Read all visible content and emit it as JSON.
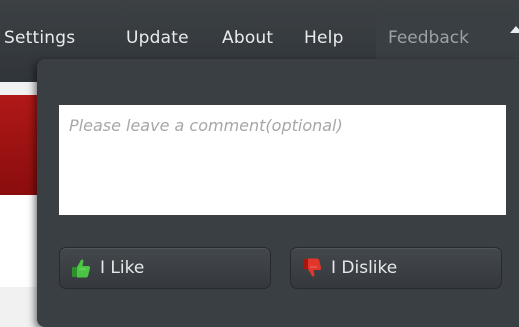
{
  "menu": {
    "settings": "Settings",
    "update": "Update",
    "about": "About",
    "help": "Help",
    "feedback": "Feedback"
  },
  "feedback_panel": {
    "comment_placeholder": "Please leave a comment(optional)",
    "comment_value": "",
    "like_label": "I Like",
    "dislike_label": "I Dislike"
  },
  "icons": {
    "like": "thumbs-up-icon",
    "dislike": "thumbs-down-icon",
    "tab_caret": "caret-up-icon"
  },
  "colors": {
    "menubar_bg": "#30353a",
    "panel_bg": "#3a3f43",
    "like_green": "#3fb33a",
    "dislike_red": "#d8261e",
    "app_accent_red": "#a51313"
  }
}
